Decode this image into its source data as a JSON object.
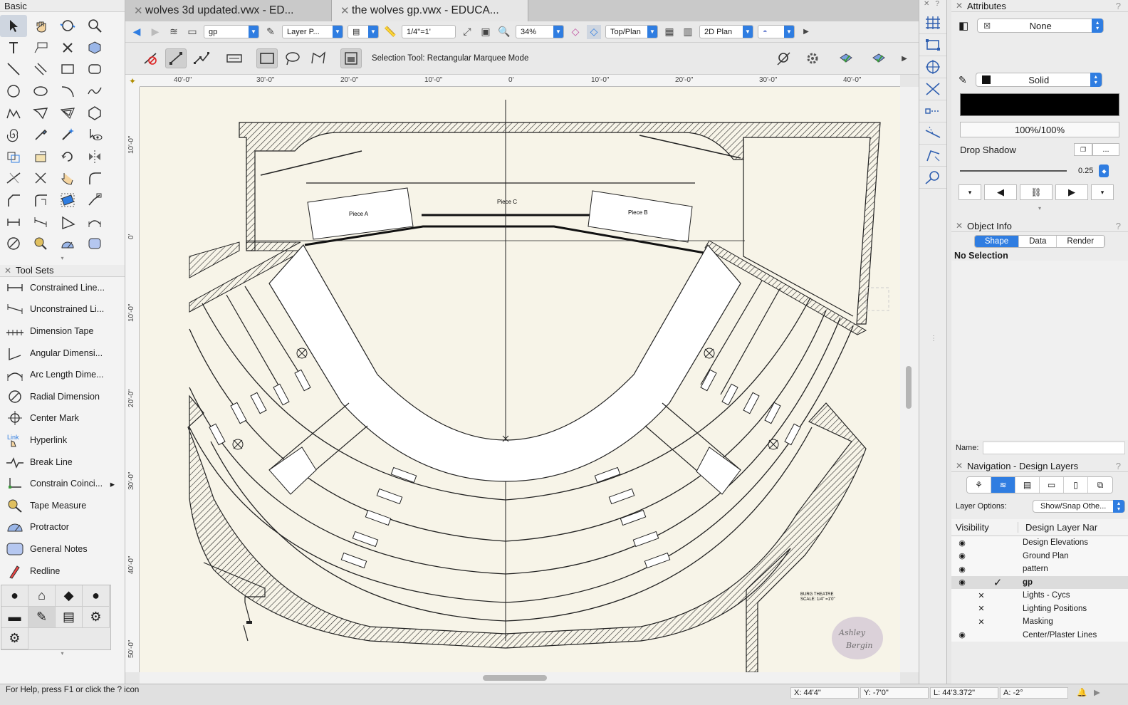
{
  "basic_palette": {
    "title": "Basic",
    "tools": [
      {
        "icon": "selection-arrow-icon"
      },
      {
        "icon": "pan-hand-icon"
      },
      {
        "icon": "flyover-icon"
      },
      {
        "icon": "zoom-icon"
      },
      {
        "icon": "spacer"
      },
      {
        "icon": "text-icon"
      },
      {
        "icon": "callout-icon"
      },
      {
        "icon": "locus-icon"
      },
      {
        "icon": "3d-locus-icon"
      },
      {
        "icon": "spacer"
      },
      {
        "icon": "line-icon"
      },
      {
        "icon": "double-line-icon"
      },
      {
        "icon": "rectangle-icon"
      },
      {
        "icon": "rounded-rectangle-icon"
      },
      {
        "icon": "spacer"
      },
      {
        "icon": "circle-icon"
      },
      {
        "icon": "oval-icon"
      },
      {
        "icon": "arc-icon"
      },
      {
        "icon": "freehand-icon"
      },
      {
        "icon": "spacer"
      },
      {
        "icon": "polyline-icon"
      },
      {
        "icon": "polygon-icon"
      },
      {
        "icon": "double-line-polygon-icon"
      },
      {
        "icon": "regular-polygon-icon"
      },
      {
        "icon": "spacer"
      },
      {
        "icon": "spiral-icon"
      },
      {
        "icon": "eyedropper-icon"
      },
      {
        "icon": "magic-wand-icon"
      },
      {
        "icon": "visibility-tool-icon"
      },
      {
        "icon": "spacer"
      },
      {
        "icon": "offset-icon"
      },
      {
        "icon": "attribute-mapping-icon"
      },
      {
        "icon": "rotate-icon"
      },
      {
        "icon": "mirror-icon"
      },
      {
        "icon": "spacer"
      },
      {
        "icon": "trim-icon"
      },
      {
        "icon": "split-icon"
      },
      {
        "icon": "reshape-icon"
      },
      {
        "icon": "fillet-icon"
      },
      {
        "icon": "spacer"
      },
      {
        "icon": "chamfer-icon"
      },
      {
        "icon": "clip-icon"
      },
      {
        "icon": "eraser-icon"
      },
      {
        "icon": "connect-combine-icon"
      },
      {
        "icon": "spacer"
      },
      {
        "icon": "dimension-icon"
      },
      {
        "icon": "angled-dimension-icon"
      },
      {
        "icon": "angular-dimension-icon"
      },
      {
        "icon": "arc-length-icon"
      },
      {
        "icon": "spacer"
      },
      {
        "icon": "radial-icon"
      },
      {
        "icon": "tape-measure-icon"
      },
      {
        "icon": "protractor-icon"
      },
      {
        "icon": "notes-icon"
      },
      {
        "icon": "spacer"
      }
    ]
  },
  "tool_sets": {
    "title": "Tool Sets",
    "items": [
      {
        "label": "Constrained Line..."
      },
      {
        "label": "Unconstrained Li..."
      },
      {
        "label": "Dimension Tape"
      },
      {
        "label": "Angular Dimensi..."
      },
      {
        "label": "Arc Length Dime..."
      },
      {
        "label": "Radial Dimension"
      },
      {
        "label": "Center Mark"
      },
      {
        "label": "Hyperlink"
      },
      {
        "label": "Break Line"
      },
      {
        "label": "Constrain Coinci..."
      },
      {
        "label": "Tape Measure"
      },
      {
        "label": "Protractor"
      },
      {
        "label": "General Notes"
      },
      {
        "label": "Redline"
      }
    ]
  },
  "tabs": [
    {
      "title": "wolves 3d updated.vwx - ED..."
    },
    {
      "title": "the wolves gp.vwx - EDUCA..."
    }
  ],
  "view_bar": {
    "class": "gp",
    "layer": "Layer P...",
    "scale": "1/4\"=1'",
    "zoom": "34%",
    "view": "Top/Plan",
    "render": "2D Plan"
  },
  "mode_bar": {
    "message": "Selection Tool: Rectangular Marquee Mode"
  },
  "rulers": {
    "top": [
      "40'-0\"",
      "30'-0\"",
      "20'-0\"",
      "10'-0\"",
      "0'",
      "10'-0\"",
      "20'-0\"",
      "30'-0\"",
      "40'-0\""
    ],
    "left": [
      "10'-0\"",
      "0'",
      "10'-0\"",
      "20'-0\"",
      "30'-0\"",
      "40'-0\"",
      "50'-0\""
    ]
  },
  "drawing": {
    "pieces": [
      "Piece A",
      "Piece C",
      "Piece B"
    ],
    "title_block_name": "BURG THEATRE",
    "title_block_scale": "SCALE: 1/4\" =1'0\"",
    "signature": "Ashley Bergin"
  },
  "attributes": {
    "title": "Attributes",
    "fill": "None",
    "pen": "Solid",
    "opacity": "100%/100%",
    "drop_shadow": "Drop Shadow",
    "line_weight": "0.25",
    "shadow_btn": "..."
  },
  "object_info": {
    "title": "Object Info",
    "tabs": [
      "Shape",
      "Data",
      "Render"
    ],
    "status": "No Selection",
    "name_label": "Name:"
  },
  "navigation": {
    "title": "Navigation - Design Layers",
    "layer_options_label": "Layer Options:",
    "layer_options_value": "Show/Snap Othe...",
    "col_visibility": "Visibility",
    "col_name": "Design Layer Nar",
    "layers": [
      {
        "name": "Design Elevations",
        "vis": "eye",
        "active": false
      },
      {
        "name": "Ground Plan",
        "vis": "eye",
        "active": false
      },
      {
        "name": "pattern",
        "vis": "eye",
        "active": false
      },
      {
        "name": "gp",
        "vis": "eye",
        "active": true
      },
      {
        "name": "Lights - Cycs",
        "vis": "x",
        "active": false
      },
      {
        "name": "Lighting Positions",
        "vis": "x",
        "active": false
      },
      {
        "name": "Masking",
        "vis": "x",
        "active": false
      },
      {
        "name": "Center/Plaster Lines",
        "vis": "eye",
        "active": false
      }
    ]
  },
  "status_bar": {
    "help": "For Help, press F1 or click the ? icon",
    "x": "X: 44'4\"",
    "y": "Y: -7'0\"",
    "l": "L: 44'3.372\"",
    "a": "A: -2°"
  },
  "colors": {
    "accent": "#2f7de1",
    "canvas": "#f7f4e8",
    "ink": "#1a1a1a"
  }
}
